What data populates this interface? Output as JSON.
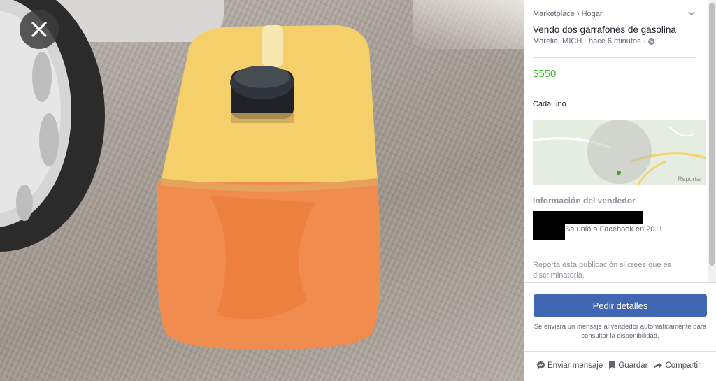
{
  "viewer": {
    "close_icon": "close-icon",
    "photo_subject": "orange plastic jerrycan"
  },
  "listing": {
    "breadcrumb": [
      "Marketplace",
      "Hogar"
    ],
    "title": "Vendo dos garrafones de gasolina",
    "location": "Morelia, MICH",
    "time_ago": "hace 6 minutos",
    "price": "$550",
    "description": "Cada uno",
    "map_link": "Reportar",
    "seller_section_title": "Información del vendedor",
    "seller_joined": "Se unió a Facebook en 2011",
    "report_text": "Reporta esta publicación si crees que es discriminatoria."
  },
  "cta": {
    "label": "Pedir detalles",
    "note": "Se enviará un mensaje al vendedor automáticamente para consultar la disponibilidad."
  },
  "actions": {
    "message": "Enviar mensaje",
    "save": "Guardar",
    "share": "Compartir"
  },
  "colors": {
    "price": "#42b72a",
    "primary_button": "#4267b2",
    "muted_text": "#616770"
  }
}
